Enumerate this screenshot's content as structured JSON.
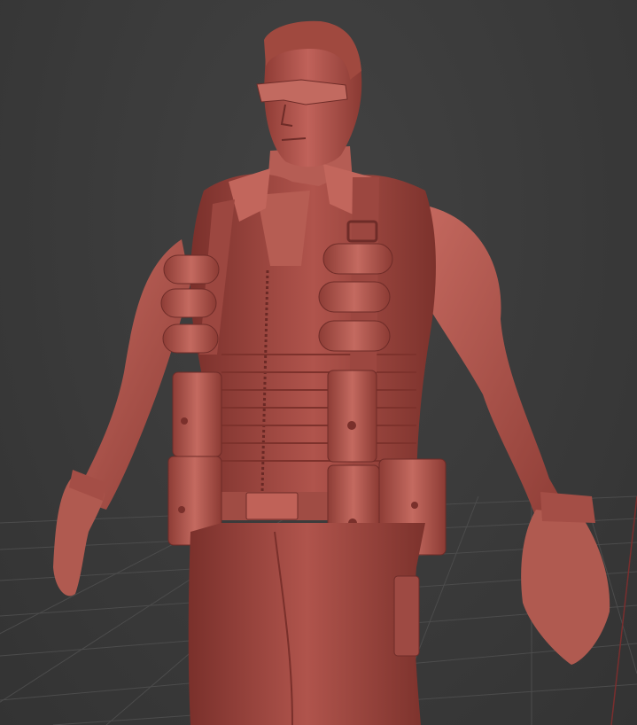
{
  "viewport": {
    "background_color": "#3a3a3a",
    "grid_color": "#4a4a4a",
    "axis_color": "#8a2a2a"
  },
  "model": {
    "material_color": "#b4564d",
    "shadow_color": "#6e2c28",
    "highlight_color": "#d27a6e"
  }
}
